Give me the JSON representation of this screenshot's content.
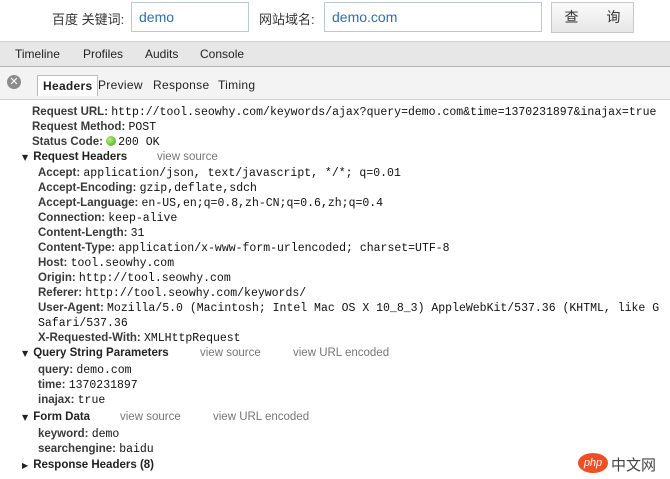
{
  "search": {
    "keyword_label": "百度 关键词:",
    "keyword_value": "demo",
    "domain_label": "网站域名:",
    "domain_value": "demo.com",
    "query_button": "查 询"
  },
  "devtools": {
    "tabs": [
      "Timeline",
      "Profiles",
      "Audits",
      "Console"
    ],
    "subtabs": [
      "Headers",
      "Preview",
      "Response",
      "Timing"
    ],
    "active_subtab": "Headers"
  },
  "general": {
    "request_url_key": "Request URL:",
    "request_url": "http://tool.seowhy.com/keywords/ajax?query=demo.com&time=1370231897&inajax=true",
    "method_key": "Request Method:",
    "method": "POST",
    "status_key": "Status Code:",
    "status": "200 OK"
  },
  "request_headers": {
    "title": "Request Headers",
    "view_source": "view source",
    "items": [
      {
        "k": "Accept:",
        "v": "application/json, text/javascript, */*; q=0.01"
      },
      {
        "k": "Accept-Encoding:",
        "v": "gzip,deflate,sdch"
      },
      {
        "k": "Accept-Language:",
        "v": "en-US,en;q=0.8,zh-CN;q=0.6,zh;q=0.4"
      },
      {
        "k": "Connection:",
        "v": "keep-alive"
      },
      {
        "k": "Content-Length:",
        "v": "31"
      },
      {
        "k": "Content-Type:",
        "v": "application/x-www-form-urlencoded; charset=UTF-8"
      },
      {
        "k": "Host:",
        "v": "tool.seowhy.com"
      },
      {
        "k": "Origin:",
        "v": "http://tool.seowhy.com"
      },
      {
        "k": "Referer:",
        "v": "http://tool.seowhy.com/keywords/"
      },
      {
        "k": "User-Agent:",
        "v": "Mozilla/5.0 (Macintosh; Intel Mac OS X 10_8_3) AppleWebKit/537.36 (KHTML, like G"
      },
      {
        "k": "",
        "v": "Safari/537.36"
      },
      {
        "k": "X-Requested-With:",
        "v": "XMLHttpRequest"
      }
    ]
  },
  "query_params": {
    "title": "Query String Parameters",
    "view_source": "view source",
    "view_url_encoded": "view URL encoded",
    "items": [
      {
        "k": "query:",
        "v": "demo.com"
      },
      {
        "k": "time:",
        "v": "1370231897"
      },
      {
        "k": "inajax:",
        "v": "true"
      }
    ]
  },
  "form_data": {
    "title": "Form Data",
    "view_source": "view source",
    "view_url_encoded": "view URL encoded",
    "items": [
      {
        "k": "keyword:",
        "v": "demo"
      },
      {
        "k": "searchengine:",
        "v": "baidu"
      }
    ]
  },
  "response_headers": {
    "title": "Response Headers (8)"
  },
  "watermark": {
    "logo_text": "php",
    "site_text": "中文网"
  },
  "colors": {
    "input_text": "#2a6fb5",
    "status_ok": "#3ea614",
    "watermark": "#f04e23"
  }
}
